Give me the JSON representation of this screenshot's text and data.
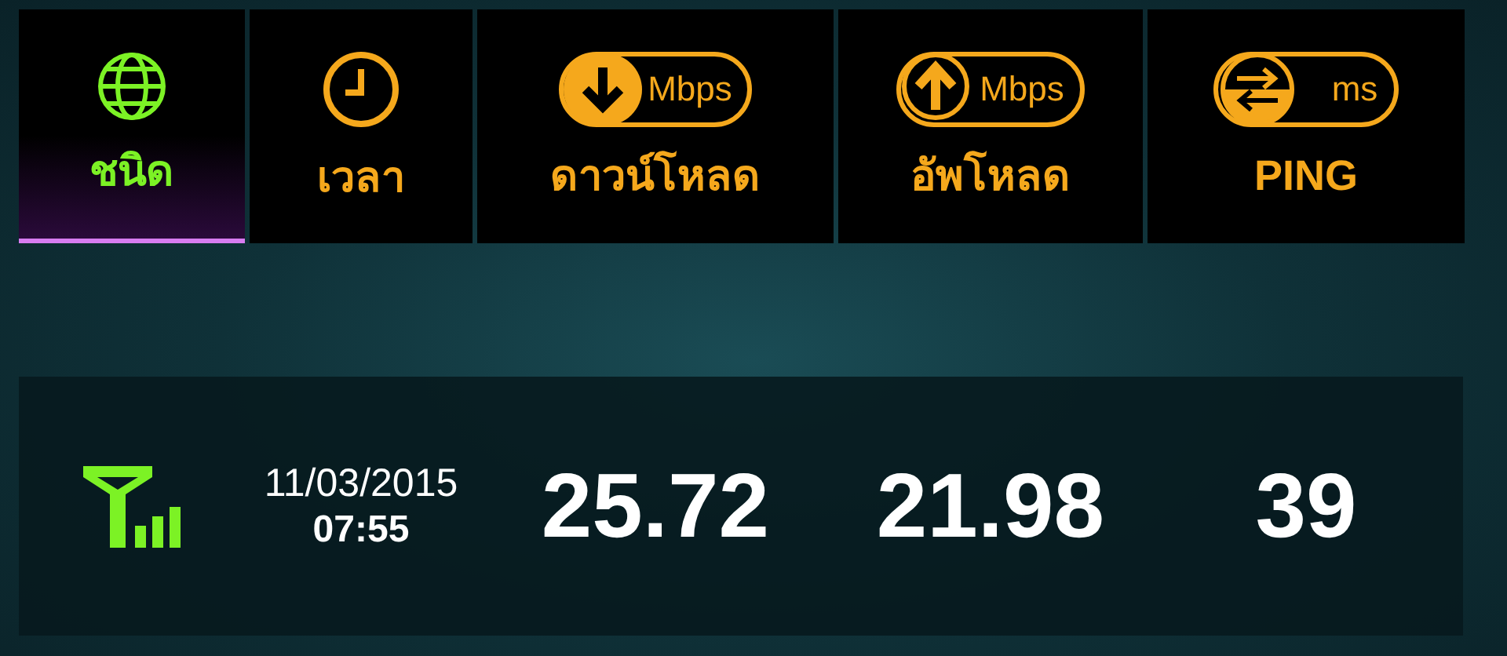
{
  "tabs": [
    {
      "kind": "globe",
      "label": "ชนิด",
      "selected": true
    },
    {
      "kind": "clock",
      "label": "เวลา",
      "selected": false
    },
    {
      "kind": "download",
      "unit": "Mbps",
      "label": "ดาวน์โหลด",
      "selected": false
    },
    {
      "kind": "upload",
      "unit": "Mbps",
      "label": "อัพโหลด",
      "selected": false
    },
    {
      "kind": "ping",
      "unit": "ms",
      "label": "PING",
      "selected": false
    }
  ],
  "results": [
    {
      "kind": "cellular",
      "date": "11/03/2015",
      "time": "07:55",
      "download": "25.72",
      "upload": "21.98",
      "ping": "39"
    }
  ]
}
